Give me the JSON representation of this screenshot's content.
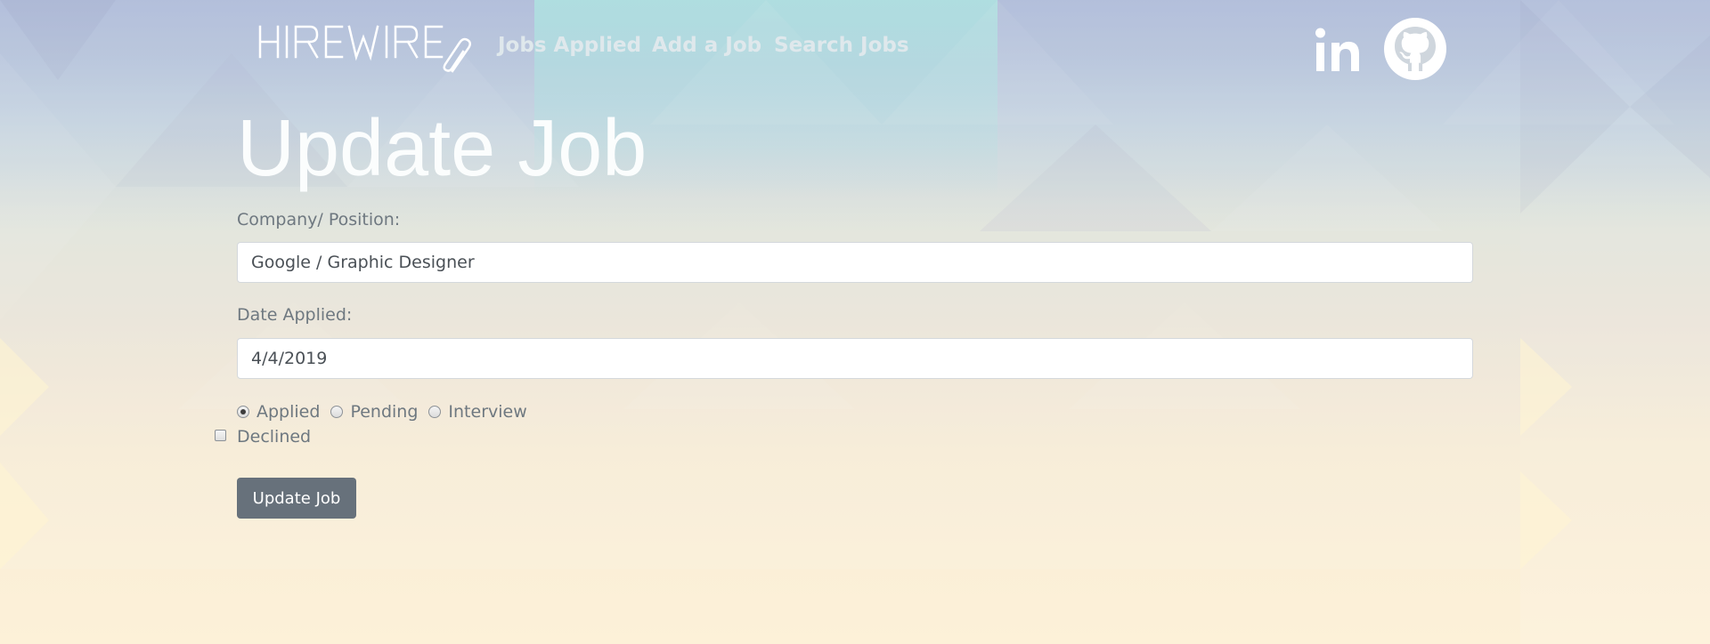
{
  "nav": {
    "brand": "HIREWIRE",
    "links": [
      {
        "label": "Jobs Applied"
      },
      {
        "label": "Add a Job"
      },
      {
        "label": "Search Jobs"
      }
    ],
    "social": [
      {
        "icon": "linkedin-icon",
        "label": "in"
      },
      {
        "icon": "github-icon"
      }
    ]
  },
  "page": {
    "title": "Update Job"
  },
  "form": {
    "company_label": "Company/ Position:",
    "company_value": "Google / Graphic Designer",
    "date_label": "Date Applied:",
    "date_value": "4/4/2019",
    "status_options": [
      {
        "label": "Applied",
        "checked": true
      },
      {
        "label": "Pending",
        "checked": false
      },
      {
        "label": "Interview",
        "checked": false
      }
    ],
    "declined_label": "Declined",
    "declined_checked": false,
    "submit_label": "Update Job"
  },
  "colors": {
    "button": "#67717b",
    "title": "#fbfdfd",
    "nav_link": "#dfe8ec"
  }
}
